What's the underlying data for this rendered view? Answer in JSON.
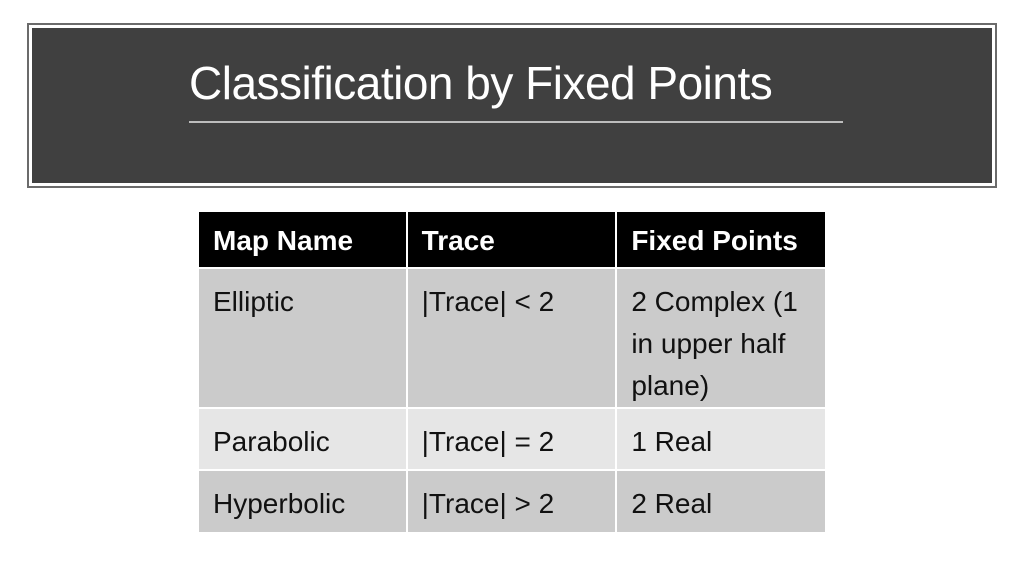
{
  "slide": {
    "title": "Classification by Fixed Points"
  },
  "table": {
    "headers": [
      "Map Name",
      "Trace",
      "Fixed Points"
    ],
    "rows": [
      [
        "Elliptic",
        "|Trace| < 2",
        "2 Complex (1 in upper half plane)"
      ],
      [
        "Parabolic",
        "|Trace| = 2",
        "1 Real"
      ],
      [
        "Hyperbolic",
        "|Trace| > 2",
        "2 Real"
      ]
    ]
  },
  "colors": {
    "title_background": "#404040",
    "title_text": "#ffffff",
    "header_background": "#000000",
    "row_dark": "#cbcbcb",
    "row_light": "#e6e6e6"
  }
}
